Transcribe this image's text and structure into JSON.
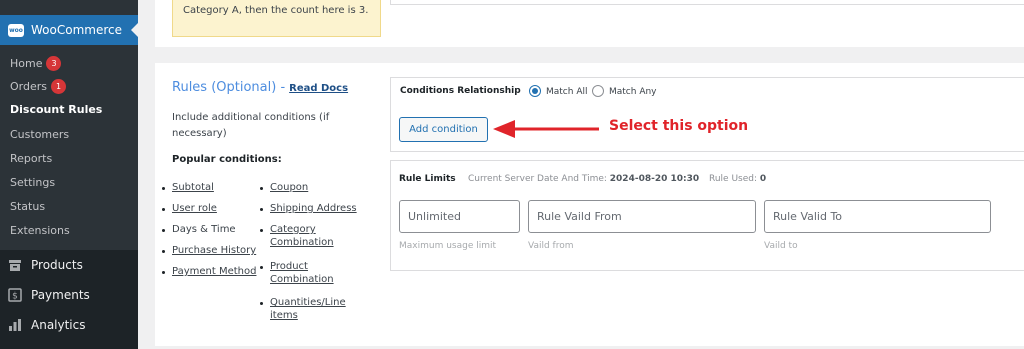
{
  "sidebar": {
    "brand": "WooCommerce",
    "logo_text": "woo",
    "items": [
      {
        "label": "Home",
        "badge": "3"
      },
      {
        "label": "Orders",
        "badge": "1"
      },
      {
        "label": "Discount Rules"
      },
      {
        "label": "Customers"
      },
      {
        "label": "Reports"
      },
      {
        "label": "Settings"
      },
      {
        "label": "Status"
      },
      {
        "label": "Extensions"
      }
    ],
    "main_items": [
      {
        "label": "Products",
        "icon": "archive-icon"
      },
      {
        "label": "Payments",
        "icon": "dollar-icon"
      },
      {
        "label": "Analytics",
        "icon": "bar-chart-icon"
      }
    ]
  },
  "top_note": "Category A, then the count here is 3.",
  "rules": {
    "title": "Rules (Optional) -",
    "read_docs": "Read Docs",
    "description": "Include additional conditions (if necessary)",
    "popular_label": "Popular conditions:",
    "left_conditions": [
      "Subtotal",
      "User role",
      "Days & Time",
      "Purchase History",
      "Payment Method"
    ],
    "right_conditions": [
      "Coupon",
      "Shipping Address",
      "Category Combination",
      "Product Combination",
      "Quantities/Line items"
    ]
  },
  "conditions": {
    "label": "Conditions Relationship",
    "match_all": "Match All",
    "match_any": "Match Any",
    "selected": "Match All",
    "add_button": "Add condition",
    "annotation": "Select this option",
    "annotation_color": "#e0242a"
  },
  "limits": {
    "label": "Rule Limits",
    "server_time_label": "Current Server Date And Time:",
    "server_time": "2024-08-20 10:30",
    "rule_used_label": "Rule Used:",
    "rule_used": "0",
    "fields": [
      {
        "placeholder": "Unlimited",
        "hint": "Maximum usage limit"
      },
      {
        "placeholder": "Rule Vaild From",
        "hint": "Vaild from"
      },
      {
        "placeholder": "Rule Valid To",
        "hint": "Vaild to"
      }
    ]
  }
}
